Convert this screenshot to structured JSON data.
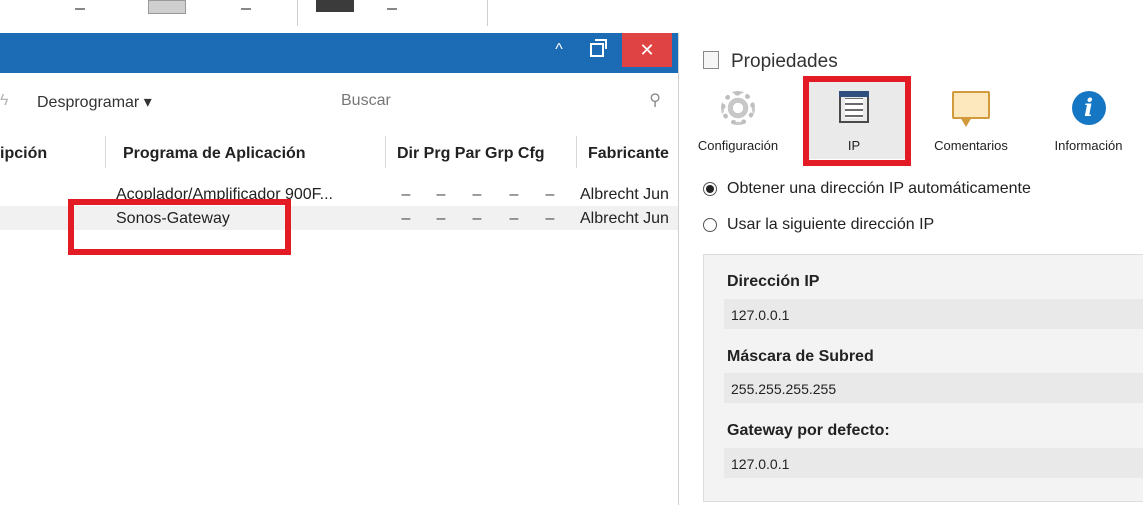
{
  "left_window": {
    "title_buttons": {
      "collapse": "^",
      "close": "✕"
    },
    "toolbar": {
      "unprogram_label": "Desprogramar ▾",
      "search_placeholder": "Buscar"
    },
    "table": {
      "headers": [
        "ipción",
        "Programa de Aplicación",
        "Dir Prg Par Grp Cfg",
        "Fabricante"
      ],
      "rows": [
        {
          "app": "Acoplador/Amplificador 900F...",
          "flags": [
            "–",
            "–",
            "–",
            "–",
            "–"
          ],
          "manufacturer": "Albrecht Jun"
        },
        {
          "app": "Sonos-Gateway",
          "flags": [
            "–",
            "–",
            "–",
            "–",
            "–"
          ],
          "manufacturer": "Albrecht Jun"
        }
      ]
    }
  },
  "properties": {
    "title": "Propiedades",
    "tabs": [
      {
        "label": "Configuración",
        "icon": "gear-icon"
      },
      {
        "label": "IP",
        "icon": "ip-document-icon"
      },
      {
        "label": "Comentarios",
        "icon": "comment-icon"
      },
      {
        "label": "Información",
        "icon": "info-icon"
      }
    ],
    "ip_options": {
      "auto": "Obtener una dirección IP automáticamente",
      "manual": "Usar la siguiente dirección IP",
      "selected": "auto"
    },
    "fields": {
      "ip_label": "Dirección IP",
      "ip_value": "127.0.0.1",
      "mask_label": "Máscara de Subred",
      "mask_value": "255.255.255.255",
      "gateway_label": "Gateway por defecto:",
      "gateway_value": "127.0.0.1"
    }
  },
  "colors": {
    "titlebar": "#1c6bb5",
    "close_button": "#e04343",
    "highlight": "#e21b25"
  }
}
